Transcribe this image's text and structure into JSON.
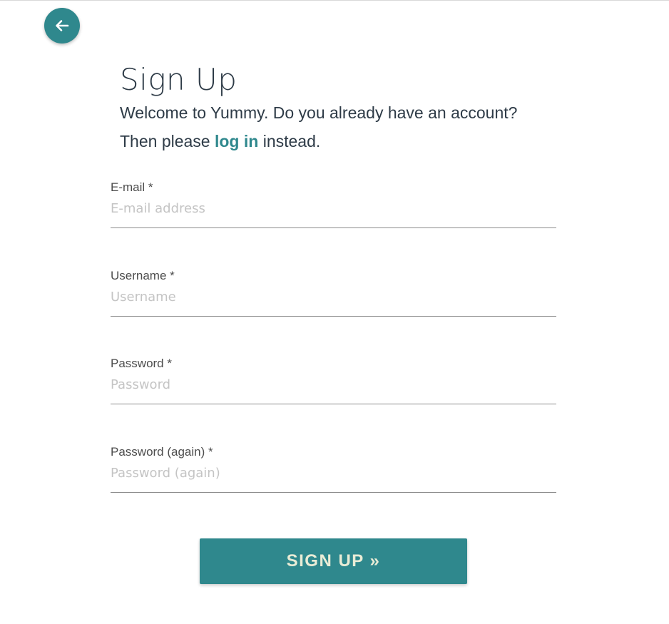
{
  "header": {
    "back_icon": "arrow-left-icon"
  },
  "page": {
    "title": "Sign Up",
    "intro_line1": "Welcome to Yummy. Do you already have an account?",
    "intro_prefix": "Then please ",
    "login_link": "log in",
    "intro_suffix": " instead."
  },
  "form": {
    "email": {
      "label": "E-mail *",
      "placeholder": "E-mail address",
      "value": ""
    },
    "username": {
      "label": "Username *",
      "placeholder": "Username",
      "value": ""
    },
    "password": {
      "label": "Password *",
      "placeholder": "Password",
      "value": ""
    },
    "password_again": {
      "label": "Password (again) *",
      "placeholder": "Password (again)",
      "value": ""
    },
    "submit_label": "SIGN UP »"
  },
  "colors": {
    "accent": "#2f888d",
    "text": "#2e3b47",
    "button_text": "#e9ecd6"
  }
}
